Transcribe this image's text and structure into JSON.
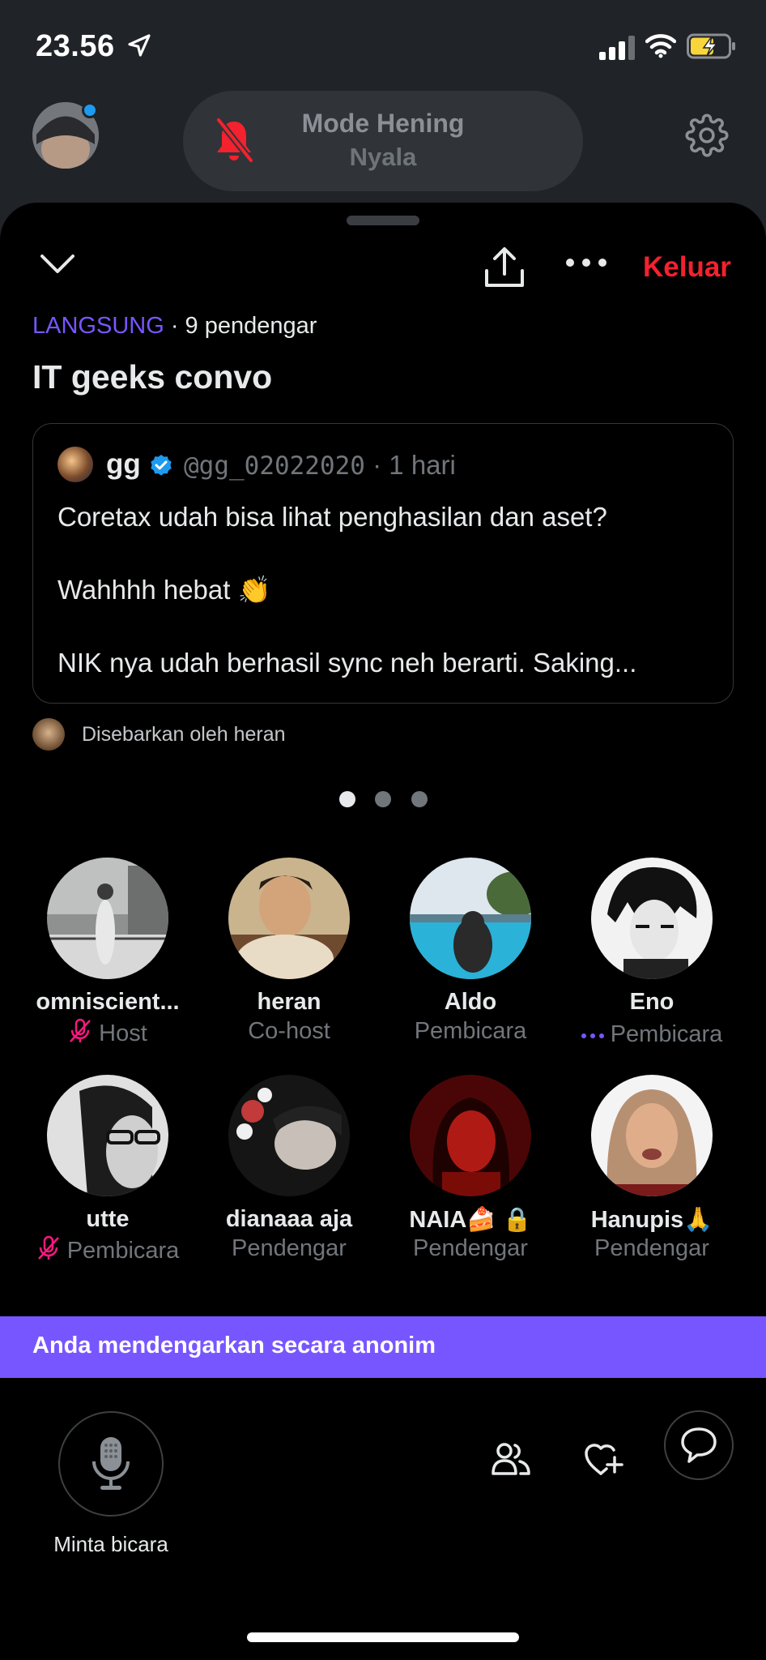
{
  "status_bar": {
    "time": "23.56"
  },
  "header": {
    "mode_title": "Mode Hening",
    "mode_subtitle": "Nyala"
  },
  "space": {
    "leave_label": "Keluar",
    "live_label": "LANGSUNG",
    "listener_count": "· 9 pendengar",
    "title": "IT geeks convo"
  },
  "pinned_tweet": {
    "name": "gg",
    "handle": "@gg_02022020",
    "time": "· 1 hari",
    "lines": [
      "Coretax udah bisa lihat penghasilan dan aset?",
      "Wahhhh hebat 👏",
      "NIK nya udah berhasil sync neh berarti. Saking..."
    ]
  },
  "shared_by": "Disebarkan oleh heran",
  "pagination": {
    "count": 3,
    "active": 0
  },
  "participants": [
    {
      "name": "omniscient...",
      "role": "Host",
      "icon": "mic-off-icon"
    },
    {
      "name": "heran",
      "role": "Co-host",
      "icon": ""
    },
    {
      "name": "Aldo",
      "role": "Pembicara",
      "icon": ""
    },
    {
      "name": "Eno",
      "role": "Pembicara",
      "icon": "speaking-dots-icon"
    },
    {
      "name": "utte",
      "role": "Pembicara",
      "icon": "mic-off-icon"
    },
    {
      "name": "dianaaa aja",
      "role": "Pendengar",
      "icon": ""
    },
    {
      "name": "NAIA🍰 🔒",
      "role": "Pendengar",
      "icon": ""
    },
    {
      "name": "Hanupis🙏",
      "role": "Pendengar",
      "icon": ""
    }
  ],
  "anon_banner": "Anda mendengarkan secara anonim",
  "bottom_bar": {
    "mic_label": "Minta bicara"
  },
  "colors": {
    "accent": "#7856ff",
    "leave": "#f4212e",
    "muted": "#f91880",
    "verified": "#1d9bf0"
  }
}
